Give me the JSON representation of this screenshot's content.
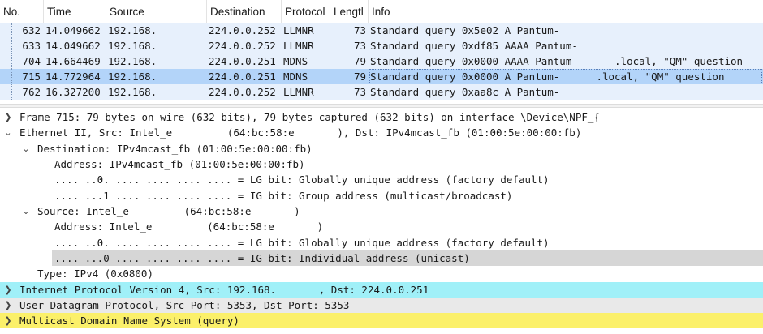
{
  "columns": {
    "no": "No.",
    "time": "Time",
    "source": "Source",
    "destination": "Destination",
    "protocol": "Protocol",
    "length": "Lengtl",
    "info": "Info"
  },
  "packets": [
    {
      "no": "632",
      "time": "14.049662",
      "source": "192.168.",
      "destination": "224.0.0.252",
      "protocol": "LLMNR",
      "length": "73",
      "info": "Standard query 0x5e02 A Pantum-"
    },
    {
      "no": "633",
      "time": "14.049662",
      "source": "192.168.",
      "destination": "224.0.0.252",
      "protocol": "LLMNR",
      "length": "73",
      "info": "Standard query 0xdf85 AAAA Pantum-"
    },
    {
      "no": "704",
      "time": "14.664469",
      "source": "192.168.",
      "destination": "224.0.0.251",
      "protocol": "MDNS",
      "length": "79",
      "info": "Standard query 0x0000 AAAA Pantum-      .local, \"QM\" question"
    },
    {
      "no": "715",
      "time": "14.772964",
      "source": "192.168.",
      "destination": "224.0.0.251",
      "protocol": "MDNS",
      "length": "79",
      "info": "Standard query 0x0000 A Pantum-      .local, \"QM\" question"
    },
    {
      "no": "762",
      "time": "16.327200",
      "source": "192.168.",
      "destination": "224.0.0.252",
      "protocol": "LLMNR",
      "length": "73",
      "info": "Standard query 0xaa8c A Pantum-"
    }
  ],
  "details": {
    "frame": "Frame 715: 79 bytes on wire (632 bits), 79 bytes captured (632 bits) on interface \\Device\\NPF_{",
    "ethernet": "Ethernet II, Src: Intel_e         (64:bc:58:e       ), Dst: IPv4mcast_fb (01:00:5e:00:00:fb)",
    "destination": "Destination: IPv4mcast_fb (01:00:5e:00:00:fb)",
    "dst_address": "Address: IPv4mcast_fb (01:00:5e:00:00:fb)",
    "dst_lg": ".... ..0. .... .... .... .... = LG bit: Globally unique address (factory default)",
    "dst_ig": ".... ...1 .... .... .... .... = IG bit: Group address (multicast/broadcast)",
    "source": "Source: Intel_e         (64:bc:58:e       )",
    "src_address": "Address: Intel_e         (64:bc:58:e       )",
    "src_lg": ".... ..0. .... .... .... .... = LG bit: Globally unique address (factory default)",
    "src_ig": ".... ...0 .... .... .... .... = IG bit: Individual address (unicast)",
    "type": "Type: IPv4 (0x0800)",
    "ip": "Internet Protocol Version 4, Src: 192.168.       , Dst: 224.0.0.251",
    "udp": "User Datagram Protocol, Src Port: 5353, Dst Port: 5353",
    "mdns": "Multicast Domain Name System (query)"
  },
  "icons": {
    "collapsed": "chevron-right-icon",
    "expanded": "chevron-down-icon"
  },
  "colors": {
    "row_bg": "#e7f0fc",
    "selected_row_bg": "#b3d4f9",
    "ip_bg": "#a0f0f8",
    "udp_bg": "#e9e9e9",
    "mdns_bg": "#fbf06a",
    "highlight_bg": "#d6d6d6"
  }
}
